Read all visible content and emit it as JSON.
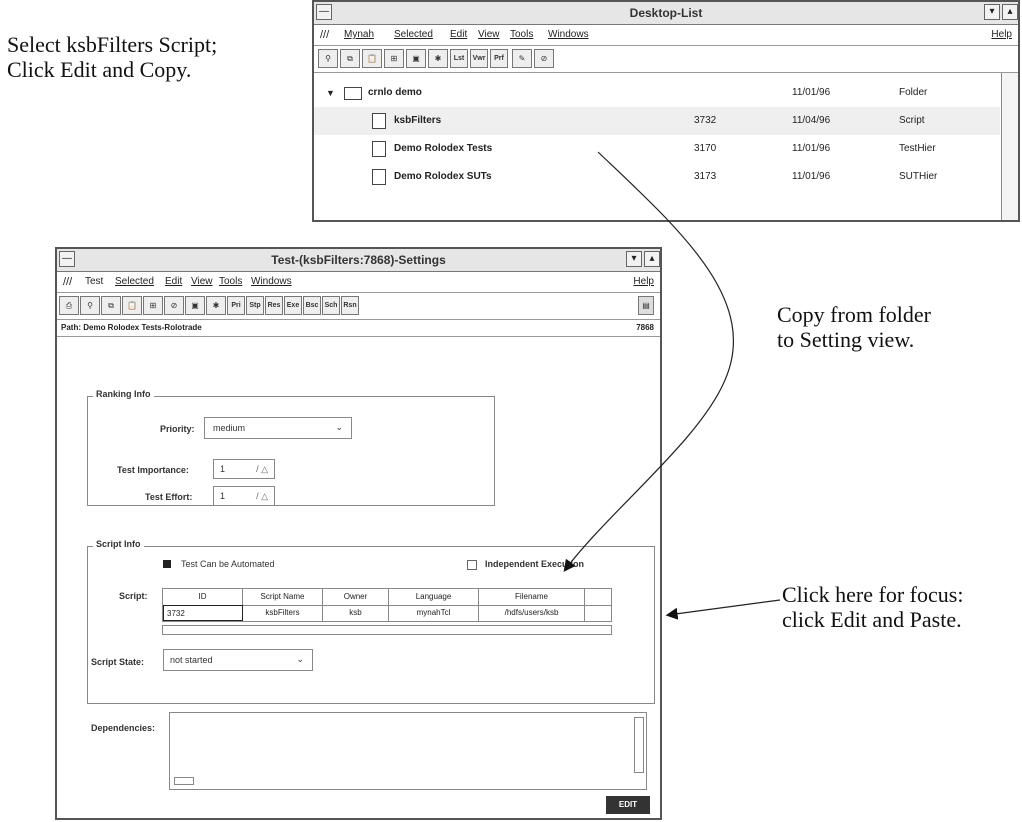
{
  "annotations": {
    "select_line1": "Select ksbFilters Script;",
    "select_line2": "Click Edit and Copy.",
    "copy_line1": "Copy from folder",
    "copy_line2": "to Setting view.",
    "click_line1": "Click here for focus:",
    "click_line2": "click Edit and Paste."
  },
  "desktop_list": {
    "title": "Desktop-List",
    "menu": [
      "Mynah",
      "Selected",
      "Edit",
      "View",
      "Tools",
      "Windows"
    ],
    "help": "Help",
    "toolbar_text": [
      "Lst",
      "Vwr",
      "Prf"
    ],
    "rows": [
      {
        "name": "crnlo demo",
        "num": "",
        "date": "11/01/96",
        "type": "Folder"
      },
      {
        "name": "ksbFilters",
        "num": "3732",
        "date": "11/04/96",
        "type": "Script"
      },
      {
        "name": "Demo Rolodex Tests",
        "num": "3170",
        "date": "11/01/96",
        "type": "TestHier"
      },
      {
        "name": "Demo Rolodex SUTs",
        "num": "3173",
        "date": "11/01/96",
        "type": "SUTHier"
      }
    ]
  },
  "settings": {
    "title": "Test-(ksbFilters:7868)-Settings",
    "menu": [
      "Test",
      "Selected",
      "Edit",
      "View",
      "Tools",
      "Windows"
    ],
    "help": "Help",
    "toolbar_text": [
      "Pri",
      "Stp",
      "Res",
      "Exe",
      "Bsc",
      "Sch",
      "Rsn"
    ],
    "path": "Path: Demo Rolodex Tests-Rolotrade",
    "path_num": "7868",
    "ranking_legend": "Ranking Info",
    "priority_label": "Priority:",
    "priority_value": "medium",
    "importance_label": "Test Importance:",
    "importance_value": "1",
    "effort_label": "Test Effort:",
    "effort_value": "1",
    "script_legend": "Script Info",
    "automated_label": "Test Can be Automated",
    "independent_label": "Independent Execution",
    "script_label": "Script:",
    "table_headers": [
      "ID",
      "Script Name",
      "Owner",
      "Language",
      "Filename"
    ],
    "table_row": [
      "3732",
      "ksbFilters",
      "ksb",
      "mynahTcl",
      "/hdfs/users/ksb"
    ],
    "state_label": "Script State:",
    "state_value": "not started",
    "dependencies_label": "Dependencies:",
    "edit_button": "EDIT"
  }
}
